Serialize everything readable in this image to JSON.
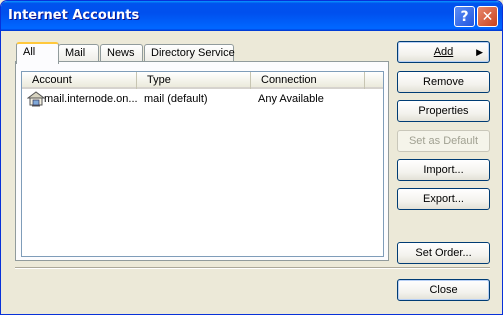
{
  "window": {
    "title": "Internet Accounts",
    "help_label": "?",
    "close_label": "✕"
  },
  "tabs": [
    {
      "label": "All",
      "active": true
    },
    {
      "label": "Mail",
      "active": false
    },
    {
      "label": "News",
      "active": false
    },
    {
      "label": "Directory Service",
      "active": false
    }
  ],
  "list": {
    "columns": [
      "Account",
      "Type",
      "Connection"
    ],
    "rows": [
      {
        "account": "mail.internode.on...",
        "type": "mail (default)",
        "connection": "Any Available",
        "icon": "mail-server-icon"
      }
    ]
  },
  "buttons": {
    "add": "Add",
    "remove": "Remove",
    "properties": "Properties",
    "set_default": "Set as Default",
    "import": "Import...",
    "export": "Export...",
    "set_order": "Set Order...",
    "close": "Close"
  },
  "colors": {
    "titlebar": "#0053ee",
    "tab_accent": "#ffc83c",
    "button_border": "#003c74"
  }
}
